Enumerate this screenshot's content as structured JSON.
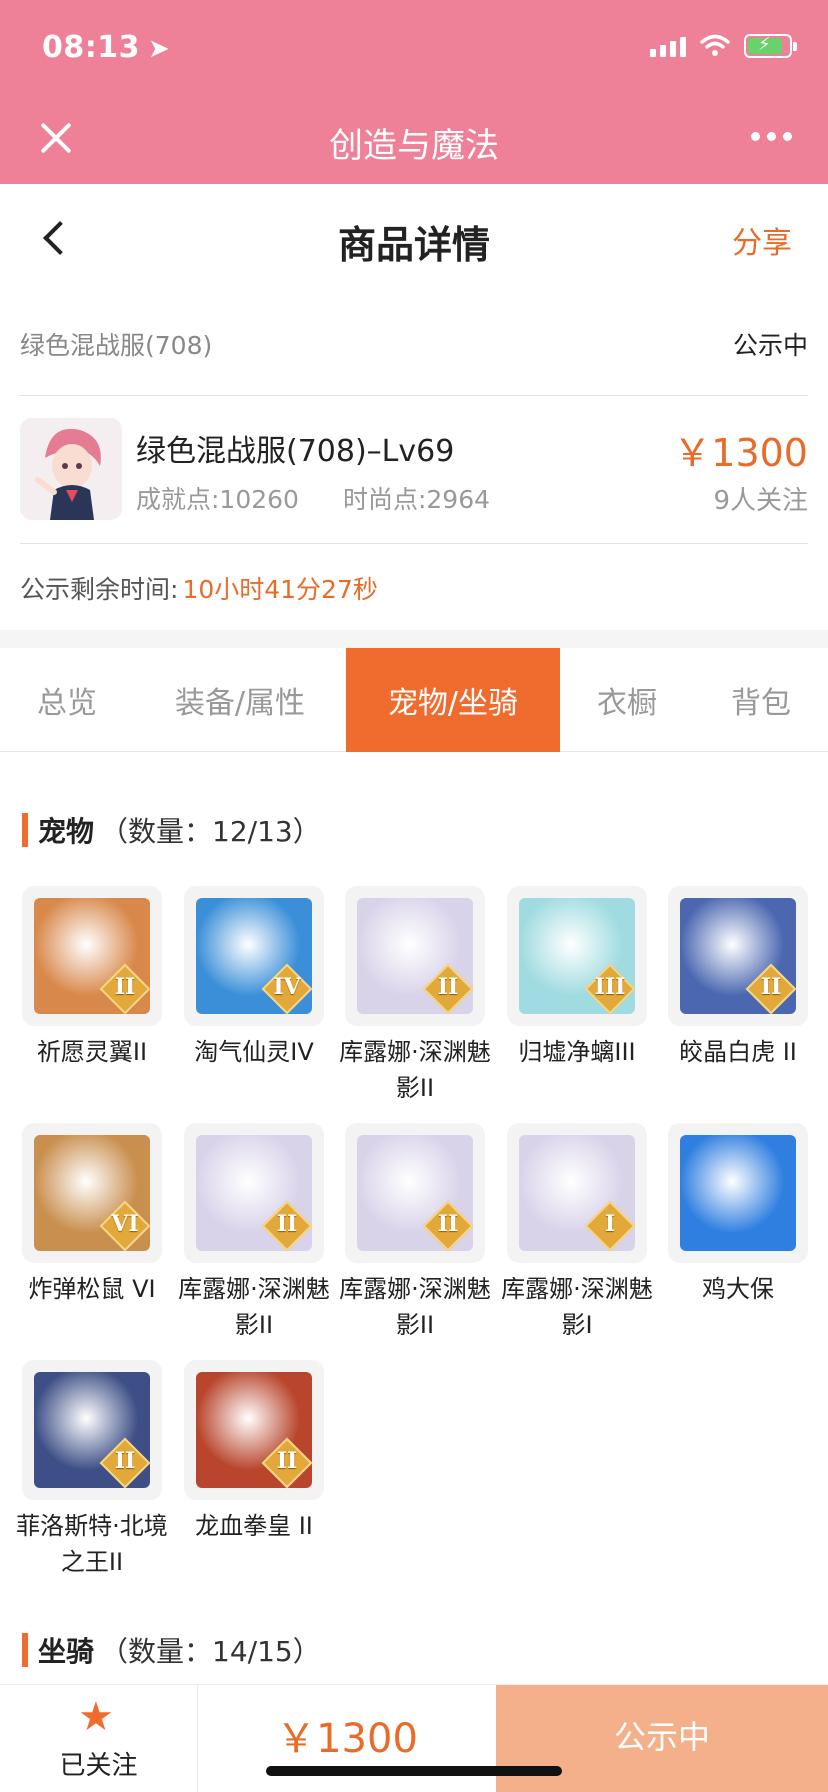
{
  "status_bar": {
    "time": "08:13"
  },
  "app_bar": {
    "title": "创造与魔法"
  },
  "nav": {
    "title": "商品详情",
    "share_label": "分享"
  },
  "server": {
    "name": "绿色混战服(708)",
    "status": "公示中"
  },
  "product": {
    "title": "绿色混战服(708)–Lv69",
    "achievement": "成就点:10260",
    "fashion": "时尚点:2964",
    "price": "￥1300",
    "followers": "9人关注"
  },
  "timer": {
    "label": "公示剩余时间:",
    "value": "10小时41分27秒"
  },
  "tabs": [
    {
      "label": "总览"
    },
    {
      "label": "装备/属性"
    },
    {
      "label": "宠物/坐骑"
    },
    {
      "label": "衣橱"
    },
    {
      "label": "背包"
    }
  ],
  "active_tab_index": 2,
  "pets_section": {
    "name": "宠物",
    "count": "（数量：12/13）"
  },
  "pets": [
    {
      "name": "祈愿灵翼II",
      "grade": "II",
      "color": "#d8884a"
    },
    {
      "name": "淘气仙灵IV",
      "grade": "IV",
      "color": "#3a8fd8"
    },
    {
      "name": "库露娜·深渊魅影II",
      "grade": "II",
      "color": "#d9d3ea"
    },
    {
      "name": "归墟净螭III",
      "grade": "III",
      "color": "#9fdbe0"
    },
    {
      "name": "皎晶白虎 II",
      "grade": "II",
      "color": "#4a67b0"
    },
    {
      "name": "炸弹松鼠 VI",
      "grade": "VI",
      "color": "#c98f4e"
    },
    {
      "name": "库露娜·深渊魅影II",
      "grade": "II",
      "color": "#d9d3ea"
    },
    {
      "name": "库露娜·深渊魅影II",
      "grade": "II",
      "color": "#d9d3ea"
    },
    {
      "name": "库露娜·深渊魅影I",
      "grade": "I",
      "color": "#d9d3ea"
    },
    {
      "name": "鸡大保",
      "grade": "",
      "color": "#2f7fe0"
    },
    {
      "name": "菲洛斯特·北境之王II",
      "grade": "II",
      "color": "#3d4f86"
    },
    {
      "name": "龙血拳皇 II",
      "grade": "II",
      "color": "#b8452c"
    }
  ],
  "mounts_section": {
    "name": "坐骑",
    "count": "（数量：14/15）"
  },
  "bottom_bar": {
    "follow_label": "已关注",
    "price": "￥1300",
    "status_label": "公示中"
  },
  "colors": {
    "accent": "#f06b2e",
    "pink": "#ee8098",
    "price": "#e86b2a",
    "status_btn": "#f3b08a"
  }
}
